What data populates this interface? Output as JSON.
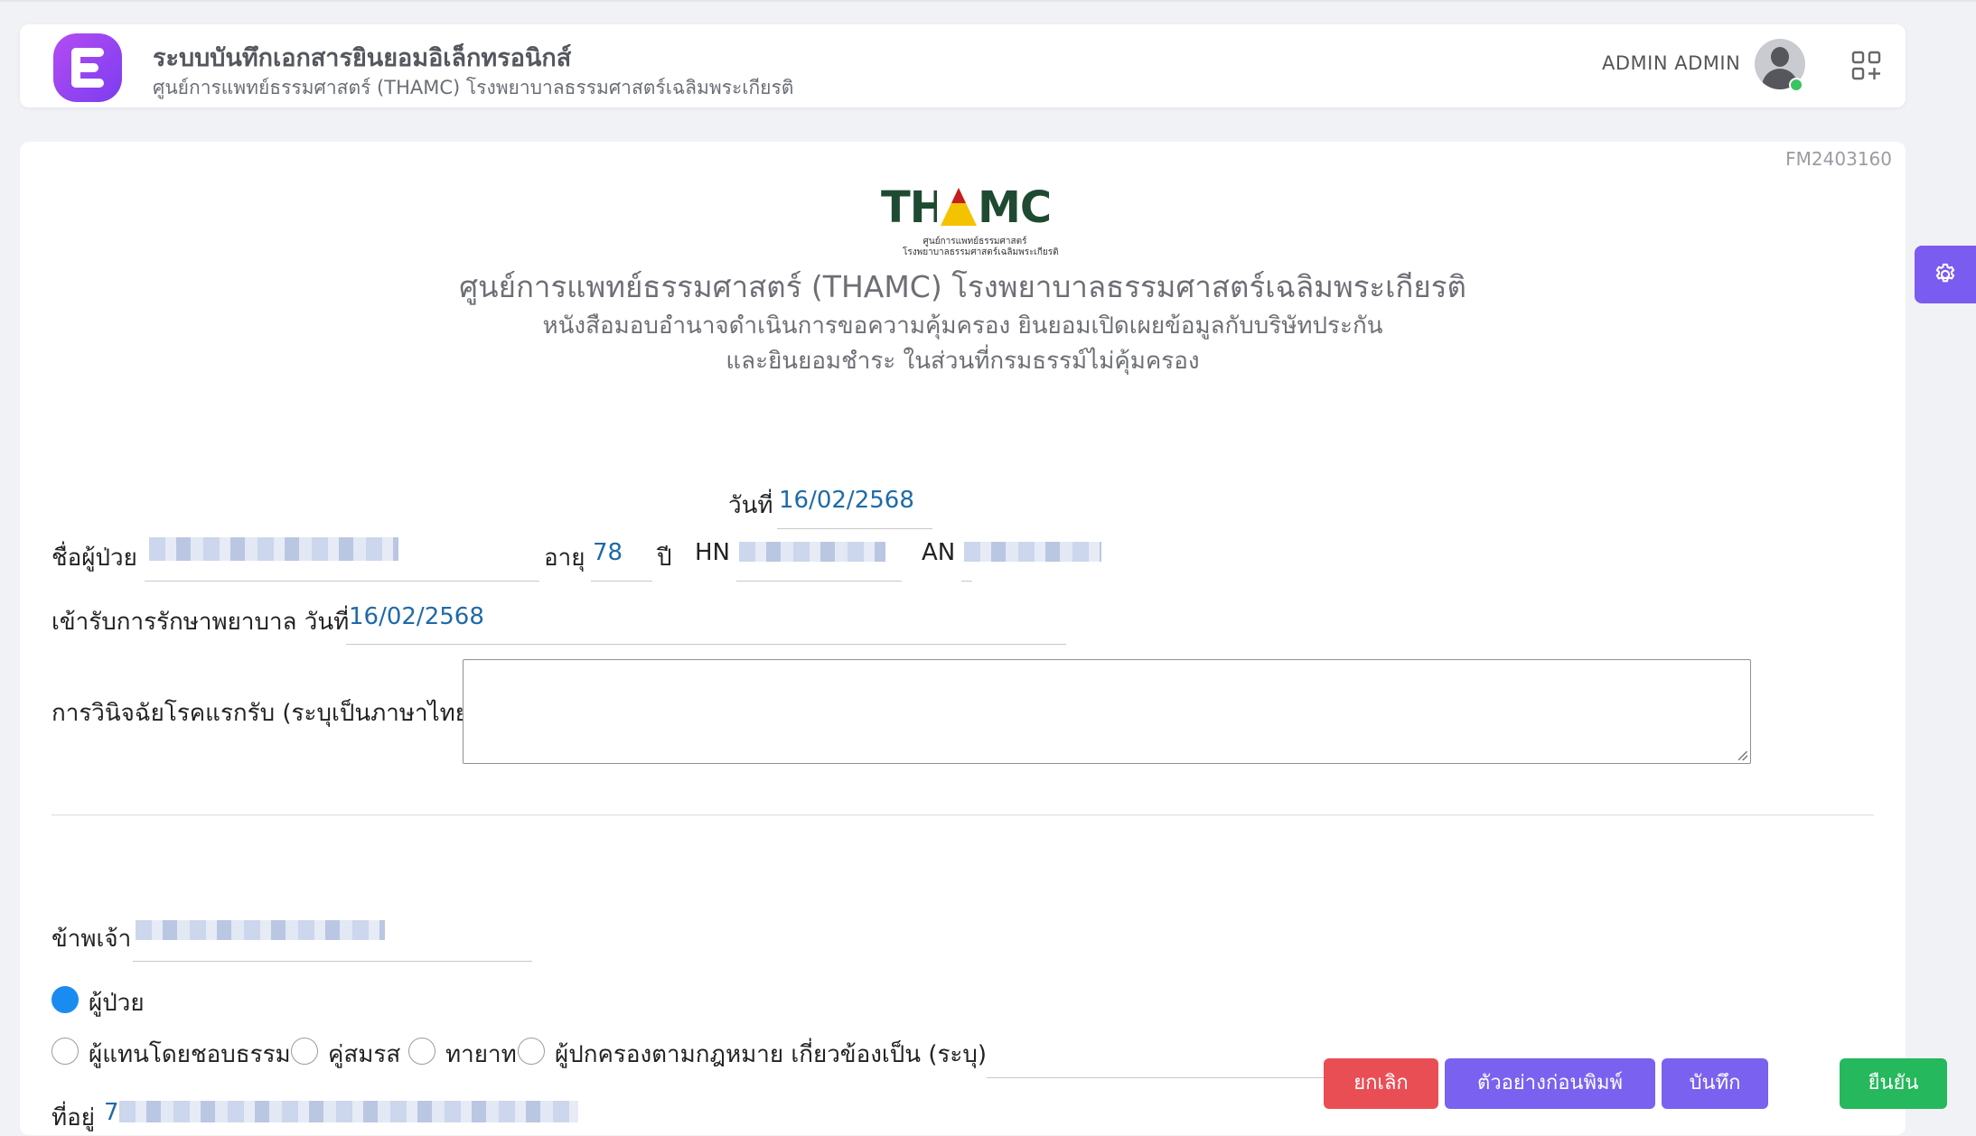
{
  "header": {
    "app_title": "ระบบบันทึกเอกสารยินยอมอิเล็กทรอนิกส์",
    "app_subtitle": "ศูนย์การแพทย์ธรรมศาสตร์ (THAMC) โรงพยาบาลธรรมศาสตร์เฉลิมพระเกียรติ",
    "user_name": "ADMIN ADMIN"
  },
  "document": {
    "form_code": "FM2403160",
    "logo_text": "THAMC",
    "logo_line1": "ศูนย์การแพทย์ธรรมศาสตร์",
    "logo_line2": "โรงพยาบาลธรรมศาสตร์เฉลิมพระเกียรติ",
    "title": "ศูนย์การแพทย์ธรรมศาสตร์ (THAMC) โรงพยาบาลธรรมศาสตร์เฉลิมพระเกียรติ",
    "subtitle_line1": "หนังสือมอบอำนาจดำเนินการขอความคุ้มครอง ยินยอมเปิดเผยข้อมูลกับบริษัทประกัน",
    "subtitle_line2": "และยินยอมชำระ ในส่วนที่กรมธรรม์ไม่คุ้มครอง"
  },
  "form": {
    "date_label": "วันที่",
    "date_value": "16/02/2568",
    "patient_name_label": "ชื่อผู้ป่วย",
    "age_label": "อายุ",
    "age_value": "78",
    "age_unit": "ปี",
    "hn_label": "HN",
    "an_label": "AN",
    "admit_label": "เข้ารับการรักษาพยาบาล วันที่",
    "admit_value": "16/02/2568",
    "diagnosis_label": "การวินิจฉัยโรคแรกรับ (ระบุเป็นภาษาไทย)",
    "diagnosis_value": "",
    "signer_label": "ข้าพเจ้า",
    "relation_options": [
      "ผู้ป่วย",
      "ผู้แทนโดยชอบธรรม",
      "คู่สมรส",
      "ทายาท",
      "ผู้ปกครองตามกฎหมาย เกี่ยวข้องเป็น (ระบุ)"
    ],
    "relation_selected": "ผู้ป่วย",
    "address_label": "ที่อยู่",
    "address_value_prefix": "7"
  },
  "actions": {
    "cancel": "ยกเลิก",
    "preview": "ตัวอย่างก่อนพิมพ์",
    "save": "บันทึก",
    "confirm": "ยืนยัน"
  },
  "colors": {
    "brand_purple": "#7b61ef",
    "danger": "#ea4e55",
    "success": "#25b85c",
    "value_blue": "#1f6aa8",
    "radio_selected": "#1a8cf0"
  }
}
